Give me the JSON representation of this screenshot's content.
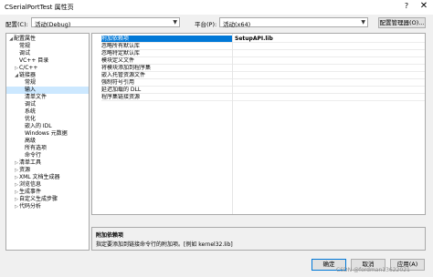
{
  "window": {
    "title": "CSerialPortTest 属性页",
    "help_glyph": "?",
    "close_glyph": "✕"
  },
  "config": {
    "config_label": "配置(C):",
    "config_value": "活动(Debug)",
    "platform_label": "平台(P):",
    "platform_value": "活动(x64)",
    "manager_button": "配置管理器(O)..."
  },
  "tree": [
    {
      "label": "配置属性",
      "expander": "◢",
      "indent": 1,
      "selected": false
    },
    {
      "label": "常规",
      "expander": "",
      "indent": 2,
      "selected": false
    },
    {
      "label": "调试",
      "expander": "",
      "indent": 2,
      "selected": false
    },
    {
      "label": "VC++ 目录",
      "expander": "",
      "indent": 2,
      "selected": false
    },
    {
      "label": "C/C++",
      "expander": "▷",
      "indent": 2,
      "selected": false
    },
    {
      "label": "链接器",
      "expander": "◢",
      "indent": 2,
      "selected": false
    },
    {
      "label": "常规",
      "expander": "",
      "indent": 3,
      "selected": false
    },
    {
      "label": "输入",
      "expander": "",
      "indent": 3,
      "selected": true
    },
    {
      "label": "清单文件",
      "expander": "",
      "indent": 3,
      "selected": false
    },
    {
      "label": "调试",
      "expander": "",
      "indent": 3,
      "selected": false
    },
    {
      "label": "系统",
      "expander": "",
      "indent": 3,
      "selected": false
    },
    {
      "label": "优化",
      "expander": "",
      "indent": 3,
      "selected": false
    },
    {
      "label": "嵌入的 IDL",
      "expander": "",
      "indent": 3,
      "selected": false
    },
    {
      "label": "Windows 元数据",
      "expander": "",
      "indent": 3,
      "selected": false
    },
    {
      "label": "高级",
      "expander": "",
      "indent": 3,
      "selected": false
    },
    {
      "label": "所有选项",
      "expander": "",
      "indent": 3,
      "selected": false
    },
    {
      "label": "命令行",
      "expander": "",
      "indent": 3,
      "selected": false
    },
    {
      "label": "清单工具",
      "expander": "▷",
      "indent": 2,
      "selected": false
    },
    {
      "label": "资源",
      "expander": "▷",
      "indent": 2,
      "selected": false
    },
    {
      "label": "XML 文档生成器",
      "expander": "▷",
      "indent": 2,
      "selected": false
    },
    {
      "label": "浏览信息",
      "expander": "▷",
      "indent": 2,
      "selected": false
    },
    {
      "label": "生成事件",
      "expander": "▷",
      "indent": 2,
      "selected": false
    },
    {
      "label": "自定义生成步骤",
      "expander": "▷",
      "indent": 2,
      "selected": false
    },
    {
      "label": "代码分析",
      "expander": "▷",
      "indent": 2,
      "selected": false
    }
  ],
  "properties": [
    {
      "name": "附加依赖项",
      "value": "SetupAPI.lib",
      "selected": true
    },
    {
      "name": "忽略所有默认库",
      "value": "",
      "selected": false
    },
    {
      "name": "忽略特定默认库",
      "value": "",
      "selected": false
    },
    {
      "name": "模块定义文件",
      "value": "",
      "selected": false
    },
    {
      "name": "将模块添加到程序集",
      "value": "",
      "selected": false
    },
    {
      "name": "嵌入托管资源文件",
      "value": "",
      "selected": false
    },
    {
      "name": "强制符号引用",
      "value": "",
      "selected": false
    },
    {
      "name": "延迟加载的 DLL",
      "value": "",
      "selected": false
    },
    {
      "name": "程序集链接资源",
      "value": "",
      "selected": false
    }
  ],
  "description": {
    "title": "附加依赖项",
    "text": "指定要添加到链接命令行的附加项。[例如 kernel32.lib]"
  },
  "footer": {
    "ok": "确定",
    "cancel": "取消",
    "apply": "应用(A)"
  },
  "watermark": "CSDN @fordman13622021"
}
